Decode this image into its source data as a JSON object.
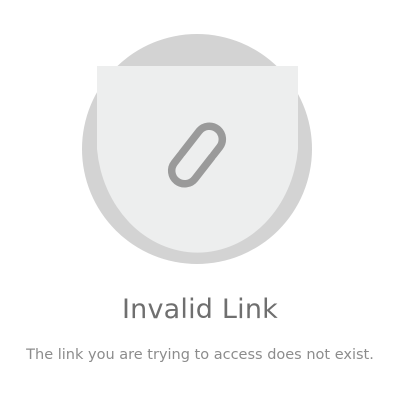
{
  "error_state": {
    "icon": "link-icon",
    "title": "Invalid Link",
    "message": "The link you are trying to access does not exist."
  },
  "colors": {
    "circle": "#d3d3d3",
    "card": "#edeeee",
    "icon": "#9a9a9a",
    "title": "#6f6f6f",
    "message": "#8c8c8c"
  }
}
